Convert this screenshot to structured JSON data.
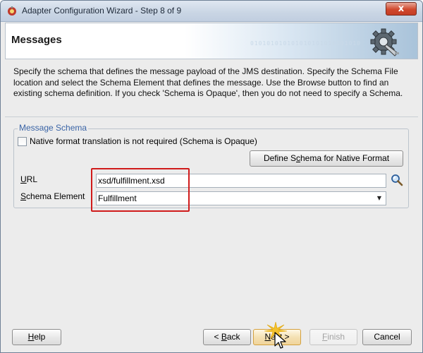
{
  "window": {
    "title": "Adapter Configuration Wizard - Step 8 of 9",
    "close_label": "x",
    "icon": "wizard-icon"
  },
  "header": {
    "title": "Messages",
    "decoration": "010101010101010101010101010",
    "icon": "gear-plug-icon"
  },
  "description": "Specify the schema that defines the message payload of the JMS destination.  Specify the Schema File location and select the Schema Element that defines the message. Use the Browse button to find an existing schema definition. If you check 'Schema is Opaque', then you do not need to specify a Schema.",
  "schema_group": {
    "legend": "Message Schema",
    "opaque_checkbox": {
      "label": "Native format translation is not required (Schema is Opaque)",
      "checked": false
    },
    "define_button": {
      "prefix": "Define S",
      "mnemonic": "c",
      "suffix": "hema for Native Format"
    },
    "url": {
      "mnemonic": "U",
      "rest": "RL",
      "value": "xsd/fulfillment.xsd",
      "browse_icon": "search-icon"
    },
    "schema_element": {
      "mnemonic": "S",
      "rest": "chema Element",
      "value": "Fulfillment",
      "arrow_icon": "dropdown-arrow-icon"
    }
  },
  "colors": {
    "highlight": "#d01b1b",
    "legend": "#3a64a6"
  },
  "footer": {
    "help": {
      "mnemonic": "H",
      "rest": "elp"
    },
    "back": {
      "arrow": "<",
      "mnemonic": "B",
      "rest": "ack"
    },
    "next": {
      "mnemonic": "N",
      "rest": "ext",
      "arrow": ">"
    },
    "finish": {
      "mnemonic": "F",
      "rest": "inish"
    },
    "cancel": {
      "label": "Cancel"
    }
  }
}
